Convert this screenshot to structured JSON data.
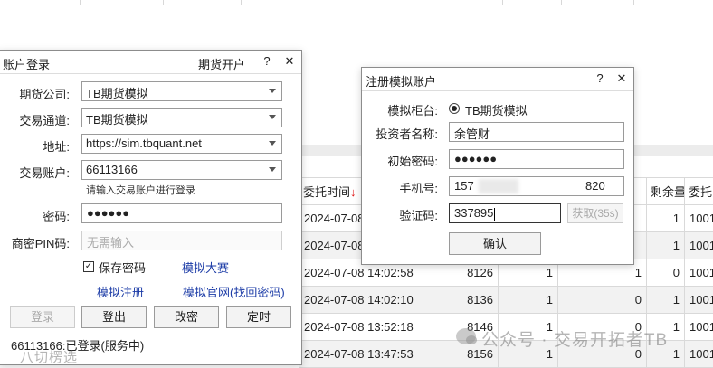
{
  "orders": {
    "headers": {
      "time": "委托时间",
      "remaining": "剩余量",
      "order_no": "委托"
    },
    "sort_arrow": "↓",
    "rows": [
      {
        "time": "2024-07-08",
        "price": "",
        "qty": "",
        "filled": "",
        "remaining": "1",
        "order_no": "1001"
      },
      {
        "time": "2024-07-08",
        "price": "",
        "qty": "",
        "filled": "",
        "remaining": "1",
        "order_no": "1001"
      },
      {
        "time": "2024-07-08 14:02:58",
        "price": "8126",
        "qty": "1",
        "filled": "1",
        "remaining": "0",
        "order_no": "1001"
      },
      {
        "time": "2024-07-08 14:02:10",
        "price": "8136",
        "qty": "1",
        "filled": "0",
        "remaining": "1",
        "order_no": "1001"
      },
      {
        "time": "2024-07-08 13:52:18",
        "price": "8146",
        "qty": "1",
        "filled": "0",
        "remaining": "1",
        "order_no": "1001"
      },
      {
        "time": "2024-07-08 13:47:53",
        "price": "8156",
        "qty": "1",
        "filled": "0",
        "remaining": "1",
        "order_no": "1001"
      }
    ]
  },
  "login": {
    "title": "账户登录",
    "open_account": "期货开户",
    "help": "?",
    "close": "✕",
    "company_label": "期货公司:",
    "company_value": "TB期货模拟",
    "channel_label": "交易通道:",
    "channel_value": "TB期货模拟",
    "address_label": "地址:",
    "address_value": "https://sim.tbquant.net",
    "account_label": "交易账户:",
    "account_value": "66113166",
    "account_hint": "请输入交易账户进行登录",
    "password_label": "密码:",
    "password_value": "●●●●●●",
    "pin_label": "商密PIN码:",
    "pin_placeholder": "无需输入",
    "save_password_label": "保存密码",
    "save_password_checked": "✓",
    "sim_contest_link": "模拟大赛",
    "sim_register_link": "模拟注册",
    "sim_site_link": "模拟官网(找回密码)",
    "login_button": "登录",
    "logout_button": "登出",
    "change_password_button": "改密",
    "timer_button": "定时",
    "status": "66113166:已登录(服务中)"
  },
  "register": {
    "title": "注册模拟账户",
    "help": "?",
    "close": "✕",
    "counter_label": "模拟柜台:",
    "counter_option": "TB期货模拟",
    "investor_label": "投资者名称:",
    "investor_value": "余管财",
    "init_password_label": "初始密码:",
    "init_password_value": "●●●●●●",
    "phone_label": "手机号:",
    "phone_prefix": "157",
    "phone_suffix": "820",
    "code_label": "验证码:",
    "code_value": "337895",
    "get_code_button": "获取(35s)",
    "confirm_button": "确认"
  },
  "watermarks": {
    "wechat_text": "公众号 · 交易开拓者TB",
    "corner_text": "八切楞选"
  }
}
